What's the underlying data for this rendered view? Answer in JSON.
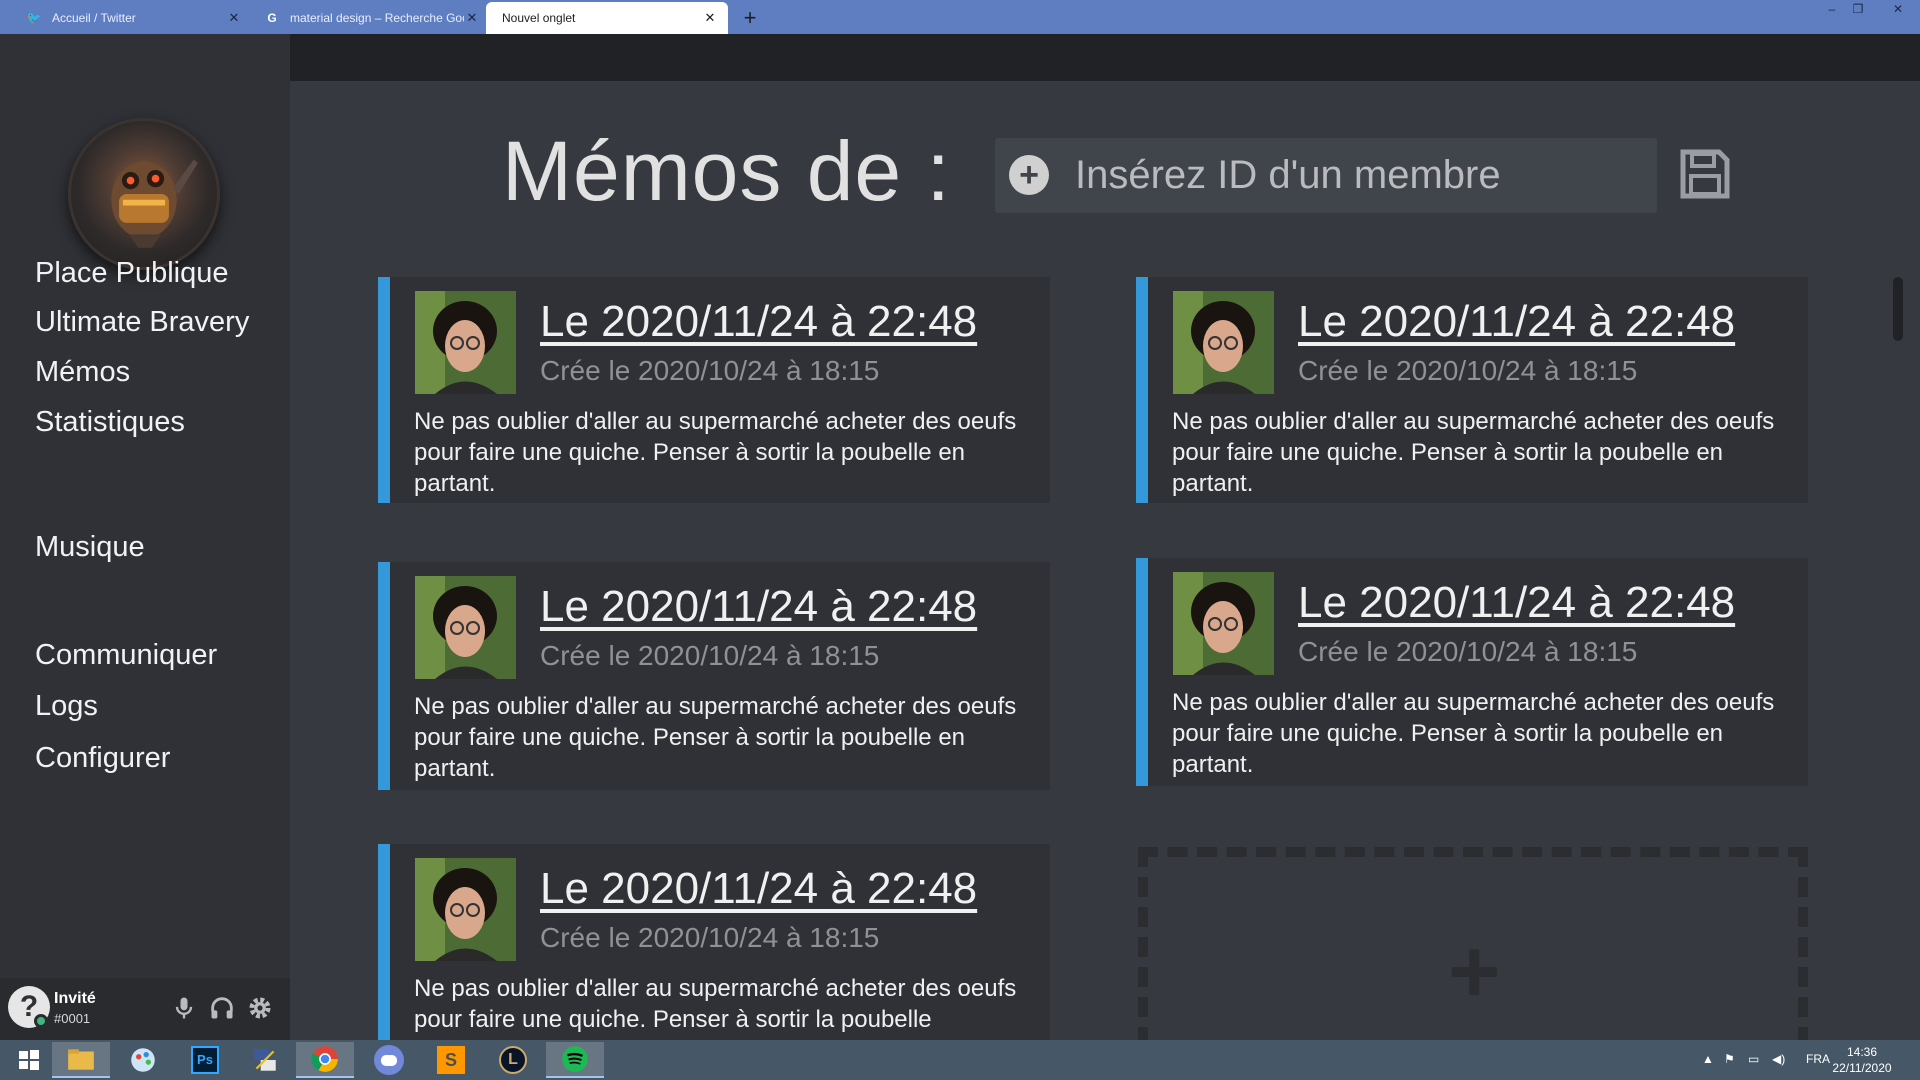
{
  "browser": {
    "tabs": [
      {
        "label": "Accueil / Twitter",
        "icon": "twitter-icon",
        "active": false
      },
      {
        "label": "material design – Recherche Goo",
        "icon": "google-icon",
        "active": false
      },
      {
        "label": "Nouvel onglet",
        "icon": "",
        "active": true
      }
    ],
    "new_tab": "+",
    "close": "✕"
  },
  "sidebar": {
    "nav_group1": [
      "Place Publique",
      "Ultimate Bravery",
      "Mémos",
      "Statistiques"
    ],
    "nav_group2": [
      "Musique"
    ],
    "nav_group3": [
      "Communiquer",
      "Logs",
      "Configurer"
    ],
    "user": {
      "name": "Invité",
      "tag": "#0001",
      "status_color": "#43b581"
    }
  },
  "header": {
    "title": "Mémos de :",
    "search_placeholder": "Insérez ID d'un membre"
  },
  "memos": [
    {
      "title": "Le 2020/11/24 à 22:48",
      "created": "Crée le 2020/10/24 à 18:15",
      "body": "Ne pas oublier d'aller au supermarché acheter des oeufs pour faire une quiche. Penser à sortir la poubelle en partant."
    },
    {
      "title": "Le 2020/11/24 à 22:48",
      "created": "Crée le 2020/10/24 à 18:15",
      "body": "Ne pas oublier d'aller au supermarché acheter des oeufs pour faire une quiche. Penser à sortir la poubelle en partant."
    },
    {
      "title": "Le 2020/11/24 à 22:48",
      "created": "Crée le 2020/10/24 à 18:15",
      "body": "Ne pas oublier d'aller au supermarché acheter des oeufs pour faire une quiche. Penser à sortir la poubelle en partant."
    },
    {
      "title": "Le 2020/11/24 à 22:48",
      "created": "Crée le 2020/10/24 à 18:15",
      "body": "Ne pas oublier d'aller au supermarché acheter des oeufs pour faire une quiche. Penser à sortir la poubelle en partant."
    },
    {
      "title": "Le 2020/11/24 à 22:48",
      "created": "Crée le 2020/10/24 à 18:15",
      "body": "Ne pas oublier d'aller au supermarché acheter des oeufs pour faire une quiche. Penser à sortir la poubelle"
    }
  ],
  "colors": {
    "accent": "#3498db",
    "background": "#36393f",
    "sidebar": "#2f3136"
  },
  "taskbar": {
    "apps": [
      "windows-start-icon",
      "file-explorer-icon",
      "paint-icon",
      "photoshop-icon",
      "network-tool-icon",
      "chrome-icon",
      "discord-icon",
      "sublime-text-icon",
      "league-of-legends-icon",
      "spotify-icon"
    ],
    "language": "FRA",
    "time": "14:36",
    "date": "22/11/2020"
  }
}
